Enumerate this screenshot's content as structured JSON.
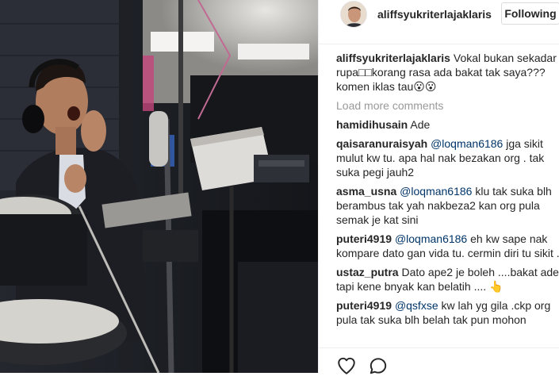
{
  "post": {
    "username": "aliffsyukriterlajaklaris",
    "follow_label": "Following"
  },
  "caption": {
    "user": "aliffsyukriterlajaklaris",
    "text": "Vokal bukan sekadar rupa□□korang rasa ada bakat tak saya??? komen iklas tau😮😮"
  },
  "load_more_label": "Load more comments",
  "comments": [
    {
      "user": "hamidihusain",
      "mention": "",
      "text": "Ade"
    },
    {
      "user": "qaisaranuraisyah",
      "mention": "@loqman6186",
      "text": "jga sikit mulut kw tu. apa hal nak bezakan org . tak suka pegi jauh2"
    },
    {
      "user": "asma_usna",
      "mention": "@loqman6186",
      "text": "klu tak suka blh berambus tak yah nakbeza2 kan org pula semak je kat sini"
    },
    {
      "user": "puteri4919",
      "mention": "@loqman6186",
      "text": "eh kw sape nak kompare dato gan vida tu. cermin diri tu sikit ."
    },
    {
      "user": "ustaz_putra",
      "mention": "",
      "text": "Dato ape2 je boleh ....bakat ade tapi kene bnyak kan belatih .... 👆"
    },
    {
      "user": "puteri4919",
      "mention": "@qsfxse",
      "text": "kw lah yg gila .ckp org pula tak suka blh belah tak pun mohon"
    }
  ],
  "icons": {
    "like": "heart-icon",
    "comment": "comment-icon"
  },
  "colors": {
    "mention": "#003569",
    "muted": "#999999",
    "border": "#efefef"
  }
}
